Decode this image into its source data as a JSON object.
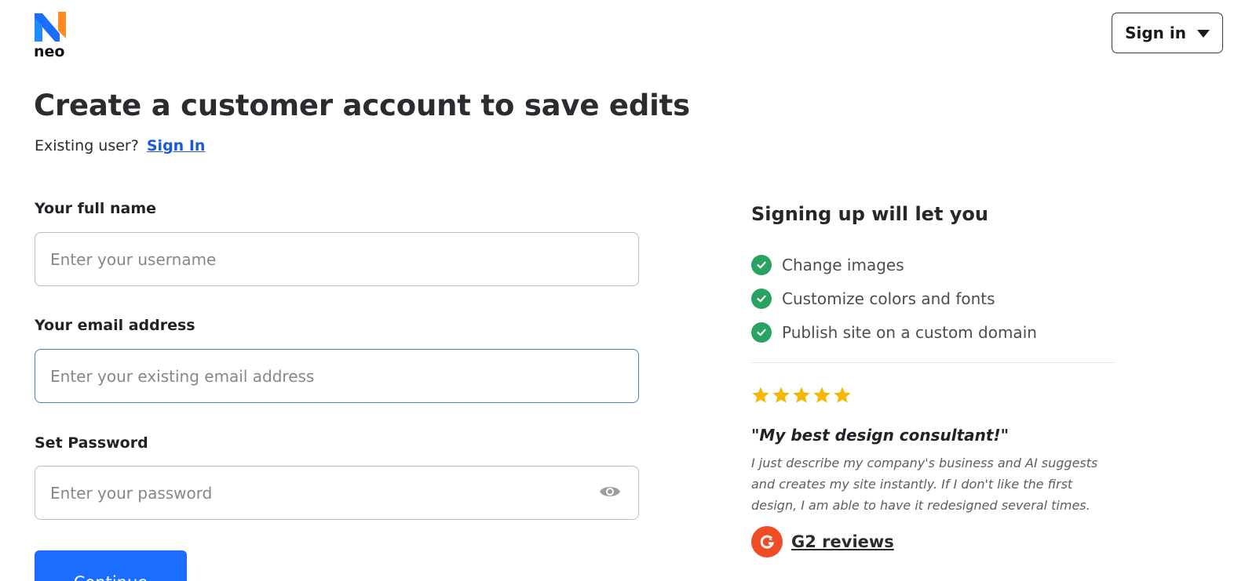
{
  "brand": {
    "name": "neo"
  },
  "header": {
    "signin_label": "Sign in"
  },
  "main": {
    "title": "Create a customer account to save edits",
    "existing_prompt": "Existing user?",
    "signin_link": "Sign In"
  },
  "form": {
    "name": {
      "label": "Your full name",
      "placeholder": "Enter your username",
      "value": ""
    },
    "email": {
      "label": "Your email address",
      "placeholder": "Enter your existing email address",
      "value": ""
    },
    "password": {
      "label": "Set Password",
      "placeholder": "Enter your password",
      "value": ""
    },
    "continue_label": "Continue"
  },
  "benefits": {
    "title": "Signing up will let you",
    "items": [
      "Change images",
      "Customize colors and fonts",
      "Publish site on a custom domain"
    ]
  },
  "testimonial": {
    "rating": 5,
    "quote": "\"My best design consultant!\"",
    "text": "I just describe my company's business and AI suggests and creates my site instantly. If I don't like the first design, I am able to have it redesigned several times.",
    "reviews_link": "G2 reviews"
  },
  "colors": {
    "primary": "#1a6dff",
    "link": "#1a5ad8",
    "check_green": "#28a361",
    "star": "#f5b800",
    "g2_red": "#ef4b25"
  }
}
